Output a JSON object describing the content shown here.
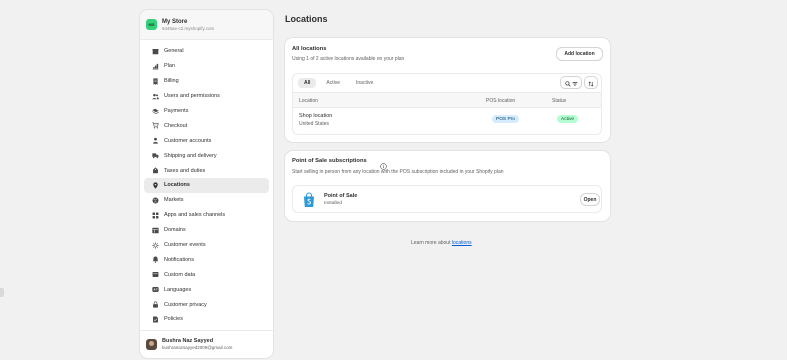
{
  "store": {
    "initials": "MS",
    "name": "My Store",
    "domain": "6445ae-c2.myshopify.com"
  },
  "sidebar": {
    "items": [
      {
        "label": "General",
        "icon": "store-icon"
      },
      {
        "label": "Plan",
        "icon": "chart-icon"
      },
      {
        "label": "Billing",
        "icon": "receipt-icon"
      },
      {
        "label": "Users and permissions",
        "icon": "users-icon"
      },
      {
        "label": "Payments",
        "icon": "payments-icon"
      },
      {
        "label": "Checkout",
        "icon": "cart-icon"
      },
      {
        "label": "Customer accounts",
        "icon": "person-icon"
      },
      {
        "label": "Shipping and delivery",
        "icon": "truck-icon"
      },
      {
        "label": "Taxes and duties",
        "icon": "tax-icon"
      },
      {
        "label": "Locations",
        "icon": "location-icon"
      },
      {
        "label": "Markets",
        "icon": "globe-icon"
      },
      {
        "label": "Apps and sales channels",
        "icon": "apps-icon"
      },
      {
        "label": "Domains",
        "icon": "domain-icon"
      },
      {
        "label": "Customer events",
        "icon": "events-icon"
      },
      {
        "label": "Notifications",
        "icon": "bell-icon"
      },
      {
        "label": "Custom data",
        "icon": "database-icon"
      },
      {
        "label": "Languages",
        "icon": "language-icon"
      },
      {
        "label": "Customer privacy",
        "icon": "lock-icon"
      },
      {
        "label": "Policies",
        "icon": "policy-icon"
      }
    ],
    "active_index": 9
  },
  "user": {
    "name": "Bushra Naz Sayyed",
    "email": "bushranazsayyed2009@gmail.com"
  },
  "page": {
    "title": "Locations"
  },
  "all_locations": {
    "title": "All locations",
    "subtitle": "Using 1 of 2 active locations available on your plan",
    "add_button": "Add location",
    "tabs": [
      "All",
      "Active",
      "Inactive"
    ],
    "columns": {
      "location": "Location",
      "pos": "POS location",
      "status": "Status"
    },
    "rows": [
      {
        "name": "Shop location",
        "country": "United States",
        "pos": "POS Pro",
        "status": "Active"
      }
    ]
  },
  "pos_subscriptions": {
    "title": "Point of Sale subscriptions",
    "subtitle": "Start selling in person from any location with the POS subscription included in your Shopify plan",
    "app": {
      "name": "Point of Sale",
      "status": "Installed",
      "open_button": "Open",
      "icon": "shopify-bag-icon"
    }
  },
  "footer": {
    "text": "Learn more about",
    "link": "locations"
  },
  "colors": {
    "accent_link": "#005bd3",
    "active_badge": "#b4fed2",
    "pos_badge": "#d5ebff",
    "store_avatar": "#36d07a"
  }
}
